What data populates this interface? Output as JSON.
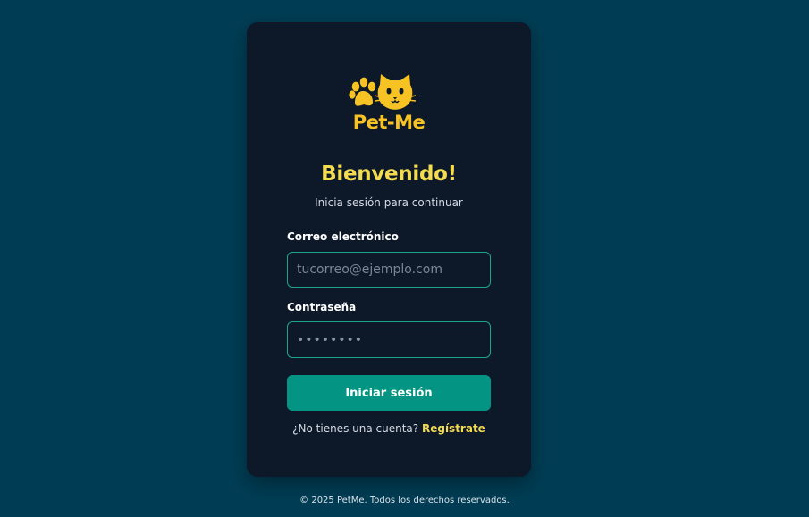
{
  "brand": {
    "name": "Pet-Me",
    "icons": [
      "paw-icon",
      "cat-icon"
    ],
    "color": "#f7c324"
  },
  "login": {
    "title": "Bienvenido!",
    "subtitle": "Inicia sesión para continuar",
    "email_label": "Correo electrónico",
    "email_placeholder": "tucorreo@ejemplo.com",
    "email_value": "",
    "password_label": "Contraseña",
    "password_value": "••••••••",
    "submit_label": "Iniciar sesión",
    "signup_prompt": "¿No tienes una cuenta?",
    "signup_link": "Regístrate"
  },
  "footer": {
    "text": "© 2025 PetMe. Todos los derechos reservados."
  },
  "colors": {
    "page_background": "#003d54",
    "card_background": "#0d1829",
    "accent": "#039483",
    "title": "#f4dc50",
    "input_border": "#1aa58b"
  }
}
